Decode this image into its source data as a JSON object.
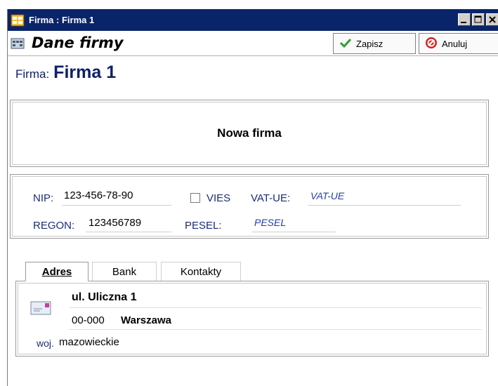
{
  "window": {
    "title": "Firma : Firma 1",
    "controls": [
      "minimize",
      "maximize",
      "close"
    ]
  },
  "header": {
    "title": "Dane firmy",
    "save_label": "Zapisz",
    "cancel_label": "Anuluj"
  },
  "company": {
    "label": "Firma:",
    "name": "Firma 1",
    "full_name": "Nowa firma"
  },
  "ids": {
    "nip_label": "NIP:",
    "nip_value": "123-456-78-90",
    "vies_label": "VIES",
    "vies_checked": false,
    "vatue_label": "VAT-UE:",
    "vatue_placeholder": "VAT-UE",
    "regon_label": "REGON:",
    "regon_value": "123456789",
    "pesel_label": "PESEL:",
    "pesel_placeholder": "PESEL"
  },
  "tabs": [
    {
      "label": "Adres",
      "active": true
    },
    {
      "label": "Bank",
      "active": false
    },
    {
      "label": "Kontakty",
      "active": false
    }
  ],
  "address": {
    "street": "ul. Uliczna 1",
    "postal_code": "00-000",
    "city": "Warszawa",
    "woj_label": "woj.",
    "voivodeship": "mazowieckie"
  },
  "colors": {
    "titlebar": "#0a246a",
    "label_blue": "#10206a",
    "save_check": "#2e9e2e",
    "cancel_red": "#d42020"
  },
  "icons": {
    "app": "form-icon",
    "header": "company-icon",
    "save": "checkmark-icon",
    "cancel": "cancel-icon",
    "address": "envelope-icon"
  }
}
